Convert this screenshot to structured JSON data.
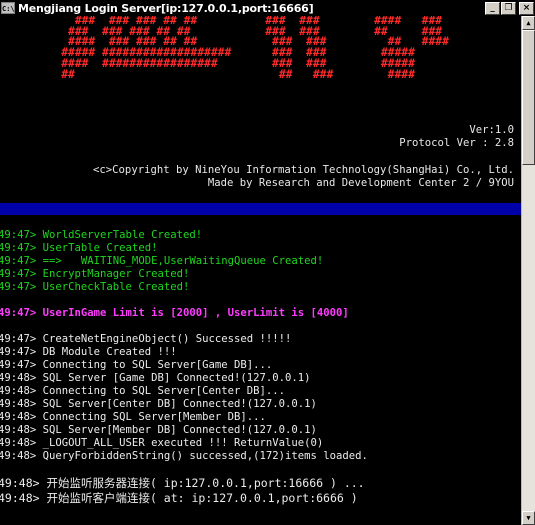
{
  "window": {
    "icon_text": "C:\\",
    "title": "Mengjiang Login Server[ip:127.0.0.1,port:16666]",
    "controls": {
      "minimize": "_",
      "restore": "❐",
      "close": "×"
    }
  },
  "banner": {
    "logo_lines": [
      "           ###  ### ### ## ##          ###  ###        ####   ###",
      "          ###  ### ### ## ##           ###  ###        ##     ###",
      "          ####  ### ### ## ##           ###  ###         ##   ####",
      "         ##### ###################      ###  ###        #####",
      "         ####  #################        ###  ###        #####",
      "         ##                              ##   ###        ####"
    ],
    "version": "Ver:1.0",
    "protocol": "Protocol Ver : 2.8",
    "copyright": "<c>Copyright by NineYou Information Technology(ShangHai) Co., Ltd.",
    "made_by": "Made by Research and Development Center 2 / 9YOU"
  },
  "log_green": [
    "49:47> WorldServerTable Created!",
    "49:47> UserTable Created!",
    "49:47> ==>   WAITING_MODE,UserWaitingQueue Created!",
    "49:47> EncryptManager Created!",
    "49:47> UserCheckTable Created!"
  ],
  "log_magenta": "49:47> UserInGame Limit is [2000] , UserLimit is [4000]",
  "log_white": [
    "49:47> CreateNetEngineObject() Successed !!!!!",
    "49:47> DB Module Created !!!",
    "49:47> Connecting to SQL Server[Game DB]...",
    "49:48> SQL Server [Game DB] Connected!(127.0.0.1)",
    "49:48> Connecting to SQL Server[Center DB]...",
    "49:48> SQL Server[Center DB] Connected!(127.0.0.1)",
    "49:48> Connecting SQL Server[Member DB]...",
    "49:48> SQL Server[Member DB] Connected!(127.0.0.1)",
    "49:48> _LOGOUT_ALL_USER executed !!! ReturnValue(0)",
    "49:48> QueryForbiddenString() successed,(172)items loaded."
  ],
  "log_tail": [
    "49:48> 开始监听服务器连接( ip:127.0.0.1,port:16666 ) ...",
    "49:48> 开始监听客户端连接( at: ip:127.0.0.1,port:6666 )"
  ],
  "colors": {
    "logo": "#ff2a2a",
    "green_text": "#1fd61f",
    "magenta_text": "#ff3dff",
    "white_text": "#ececec",
    "separator_bar": "#0000a8",
    "background": "#000000"
  }
}
